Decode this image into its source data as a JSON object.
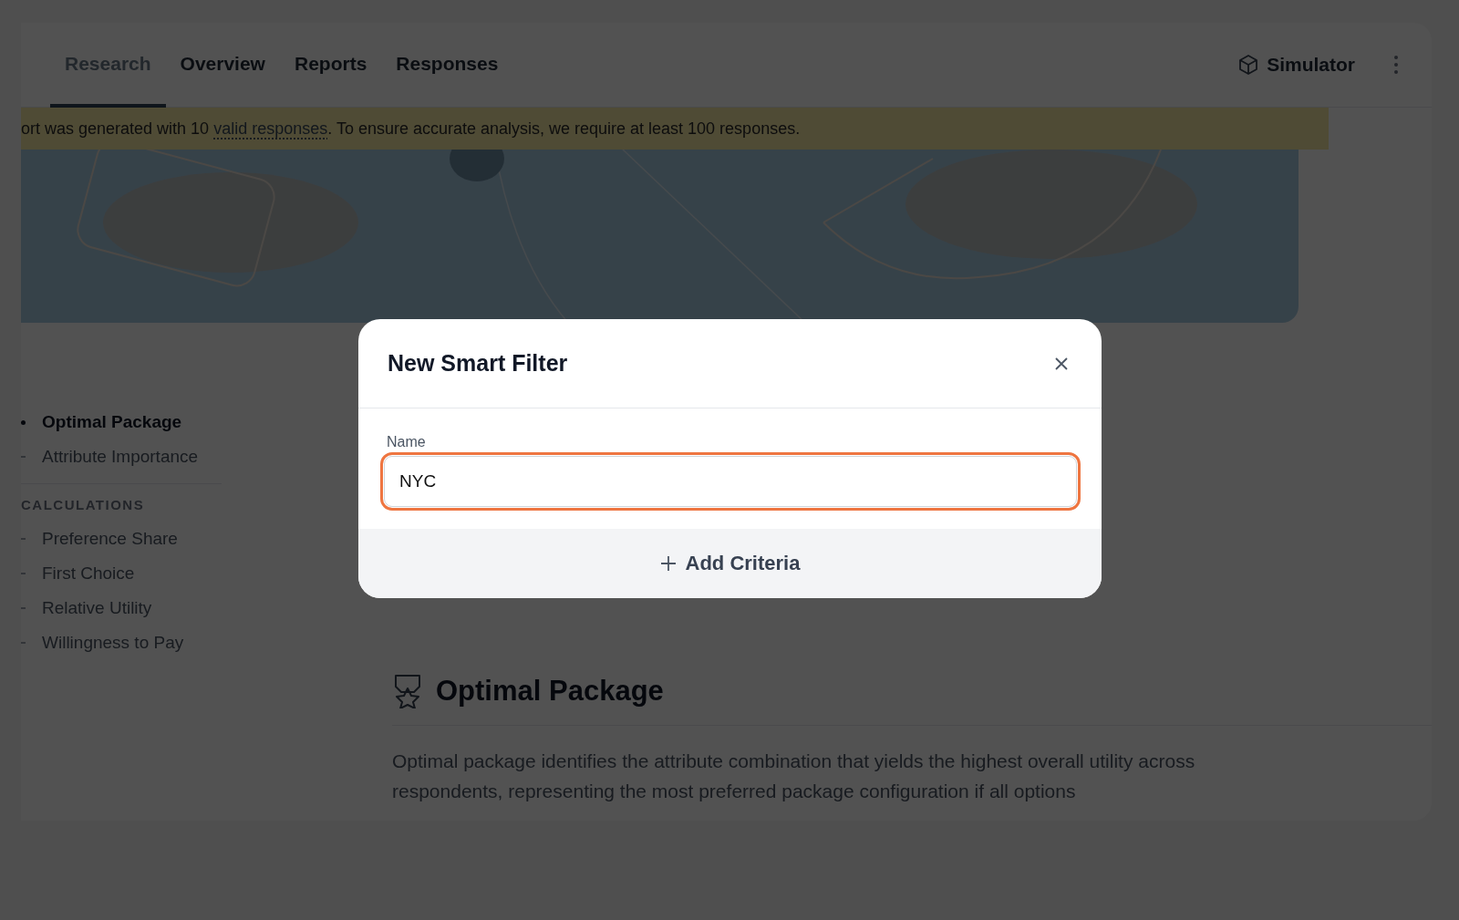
{
  "tabs": [
    {
      "label": "Research",
      "selected": true
    },
    {
      "label": "Overview",
      "selected": false
    },
    {
      "label": "Reports",
      "selected": false
    },
    {
      "label": "Responses",
      "selected": false
    }
  ],
  "toolbar": {
    "simulator": "Simulator"
  },
  "banner": {
    "before": "ort was generated with 10 ",
    "link": "valid responses",
    "after": ". To ensure accurate analysis, we require at least 100 responses."
  },
  "sidebar": {
    "groups": [
      {
        "items": [
          {
            "label": "Optimal Package",
            "selected": true
          },
          {
            "label": "Attribute Importance",
            "selected": false
          }
        ]
      },
      {
        "heading": "CALCULATIONS",
        "items": [
          {
            "label": "Preference Share",
            "selected": false
          },
          {
            "label": "First Choice",
            "selected": false
          },
          {
            "label": "Relative Utility",
            "selected": false
          },
          {
            "label": "Willingness to Pay",
            "selected": false
          }
        ]
      }
    ]
  },
  "section": {
    "title": "Optimal Package",
    "description": "Optimal package identifies the attribute combination that yields the highest overall utility across respondents, representing the most preferred package configuration if all options"
  },
  "modal": {
    "title": "New Smart Filter",
    "field": {
      "label": "Name",
      "value": "NYC",
      "focused": true
    },
    "add_button": "Add Criteria"
  }
}
